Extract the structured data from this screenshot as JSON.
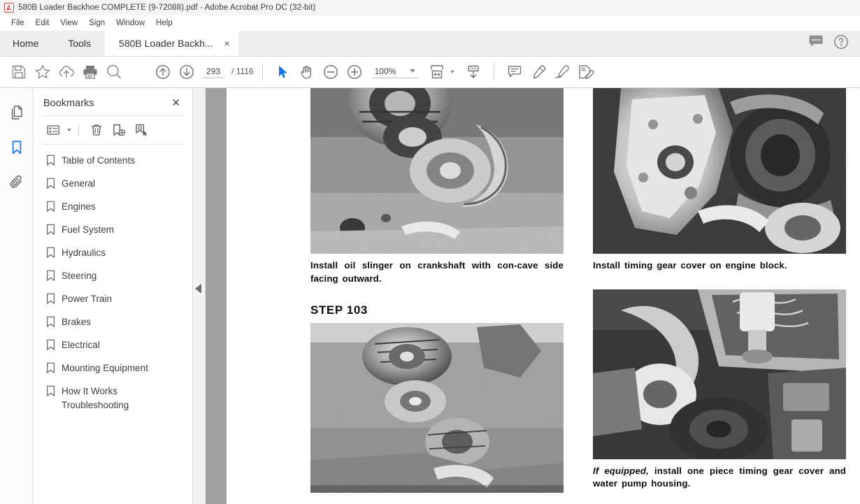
{
  "window": {
    "title": "580B Loader Backhoe COMPLETE (9-72088).pdf - Adobe Acrobat Pro DC (32-bit)",
    "app_icon": "acrobat-logo-icon"
  },
  "menubar": {
    "items": [
      "File",
      "Edit",
      "View",
      "Sign",
      "Window",
      "Help"
    ]
  },
  "tabs": {
    "home_label": "Home",
    "tools_label": "Tools",
    "document_label": "580B Loader Backh...",
    "close_glyph": "×",
    "right_icons": [
      "comment-bubble-icon",
      "help-circle-icon"
    ]
  },
  "toolbar": {
    "icons": [
      "save-icon",
      "add-to-favorites-star-icon",
      "upload-cloud-icon",
      "print-icon",
      "find-search-icon",
      "previous-page-icon",
      "next-page-icon"
    ],
    "page_current": "293",
    "page_total": "/ 1116",
    "select_tool": "select-cursor-icon",
    "hand_tool": "hand-pan-icon",
    "zoom_out": "zoom-out-minus-icon",
    "zoom_in": "zoom-in-plus-icon",
    "zoom_value": "100%",
    "fit_page_icon": "fit-width-icon",
    "scroll_mode_icon": "page-display-icon",
    "comment_icon": "add-comment-icon",
    "highlight_icon": "highlight-marker-icon",
    "draw_icon": "draw-freehand-icon",
    "sign_icon": "fill-and-sign-icon"
  },
  "rail": {
    "items": [
      {
        "name": "page-thumbnails-icon",
        "selected": false
      },
      {
        "name": "bookmarks-icon",
        "selected": true
      },
      {
        "name": "attachments-paperclip-icon",
        "selected": false
      }
    ],
    "accent_color": "#1473e6"
  },
  "bookmarks_panel": {
    "title": "Bookmarks",
    "close_glyph": "✕",
    "tools": [
      "bookmark-options-list-icon",
      "delete-bookmark-trash-icon",
      "new-bookmark-icon",
      "bookmark-target-icon"
    ],
    "items": [
      "Table of Contents",
      "General",
      "Engines",
      "Fuel System",
      "Hydraulics",
      "Steering",
      "Power Train",
      "Brakes",
      "Electrical",
      "Mounting Equipment",
      "How It Works\nTroubleshooting"
    ]
  },
  "document": {
    "left_column": {
      "photo_1_alt": "black-and-white-photo-hand-installing-oil-slinger-on-crankshaft",
      "caption_1": "Install oil slinger on crankshaft with con-cave side facing outward.",
      "step_label": "STEP 103",
      "photo_2_alt": "black-and-white-photo-timing-gears-and-crankshaft-on-engine-block"
    },
    "right_column": {
      "photo_1_alt": "black-and-white-photo-hand-installing-timing-gear-cover-on-engine-block",
      "caption_1": "Install timing gear cover on engine block.",
      "photo_2_alt": "black-and-white-photo-one-piece-timing-gear-cover-and-water-pump-housing",
      "caption_2_italic": "If equipped,",
      "caption_2_rest": " install one piece timing gear cover and water pump housing."
    }
  },
  "colors": {
    "titlebar_bg": "#f5f5f5",
    "tabstrip_bg": "#eeeeee",
    "active_tab_bg": "#ffffff",
    "gutter_dark": "#a0a0a0",
    "accent_blue": "#1473e6",
    "scrollbar_thumb": "#1d1d1d"
  }
}
